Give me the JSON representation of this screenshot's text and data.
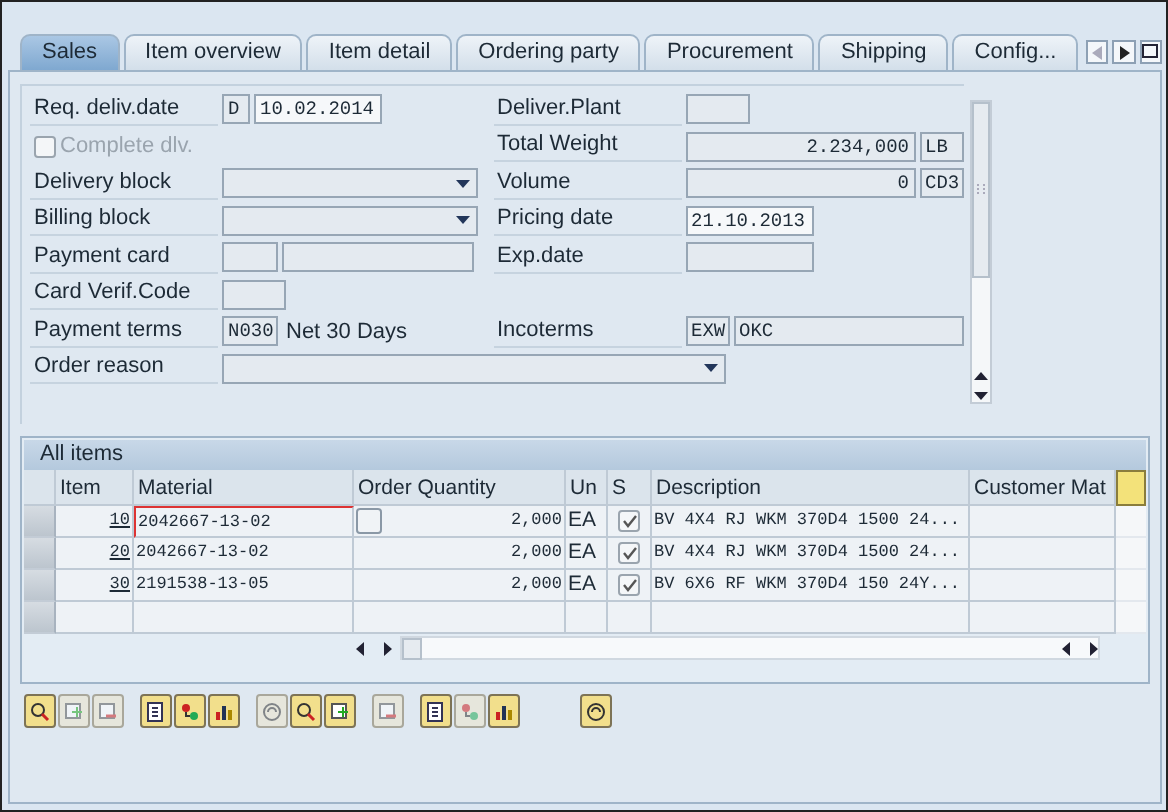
{
  "tabs": [
    {
      "label": "Sales",
      "selected": true
    },
    {
      "label": "Item overview",
      "selected": false
    },
    {
      "label": "Item detail",
      "selected": false
    },
    {
      "label": "Ordering party",
      "selected": false
    },
    {
      "label": "Procurement",
      "selected": false
    },
    {
      "label": "Shipping",
      "selected": false
    },
    {
      "label": "Config...",
      "selected": false
    }
  ],
  "form": {
    "rows": [
      {
        "left": {
          "kind": "label",
          "label": "Req. deliv.date",
          "controls": [
            {
              "kind": "flag",
              "value": "D"
            },
            {
              "kind": "date",
              "value": "10.02.2014"
            }
          ]
        },
        "right": {
          "kind": "label",
          "label": "Deliver.Plant",
          "controls": [
            {
              "kind": "short"
            }
          ]
        }
      },
      {
        "left": {
          "kind": "checkbox",
          "label": "Complete dlv.",
          "checked": false,
          "disabled": true
        },
        "right": {
          "kind": "label",
          "label": "Total Weight",
          "controls": [
            {
              "kind": "amount",
              "value": "2.234,000"
            },
            {
              "kind": "unit",
              "value": "LB"
            }
          ]
        }
      },
      {
        "left": {
          "kind": "label",
          "label": "Delivery block",
          "controls": [
            {
              "kind": "dropdown"
            }
          ]
        },
        "right": {
          "kind": "label",
          "label": "Volume",
          "controls": [
            {
              "kind": "amount",
              "value": "0"
            },
            {
              "kind": "unit",
              "value": "CD3"
            }
          ]
        }
      },
      {
        "left": {
          "kind": "label",
          "label": "Billing block",
          "controls": [
            {
              "kind": "dropdown"
            }
          ]
        },
        "right": {
          "kind": "label",
          "label": "Pricing date",
          "controls": [
            {
              "kind": "date",
              "value": "21.10.2013"
            }
          ]
        }
      },
      {
        "left": {
          "kind": "label",
          "label": "Payment card",
          "controls": [
            {
              "kind": "code"
            },
            {
              "kind": "medium"
            }
          ]
        },
        "right": {
          "kind": "label",
          "label": "Exp.date",
          "controls": [
            {
              "kind": "date"
            }
          ]
        }
      },
      {
        "left": {
          "kind": "label",
          "label": "Card Verif.Code",
          "controls": [
            {
              "kind": "short"
            }
          ]
        }
      },
      {
        "left": {
          "kind": "label",
          "label": "Payment terms",
          "controls": [
            {
              "kind": "code",
              "value": "N030"
            },
            {
              "kind": "text",
              "value": "Net 30 Days"
            }
          ]
        },
        "right": {
          "kind": "label",
          "label": "Incoterms",
          "controls": [
            {
              "kind": "unit",
              "value": "EXW"
            },
            {
              "kind": "wide",
              "value": "OKC"
            }
          ]
        }
      },
      {
        "left": {
          "kind": "label",
          "label": "Order reason",
          "controls": [
            {
              "kind": "longdropdown"
            }
          ]
        }
      }
    ]
  },
  "table": {
    "title": "All items",
    "columns": [
      "Item",
      "Material",
      "Order Quantity",
      "Un",
      "S",
      "Description",
      "Customer Mat"
    ],
    "rows": [
      {
        "item": "10",
        "material": "2042667-13-02",
        "quantity": "2,000",
        "unit": "EA",
        "status": true,
        "description": "BV 4X4 RJ WKM 370D4 1500 24...",
        "focused": true
      },
      {
        "item": "20",
        "material": "2042667-13-02",
        "quantity": "2,000",
        "unit": "EA",
        "status": true,
        "description": "BV 4X4 RJ WKM 370D4 1500 24...",
        "focused": false
      },
      {
        "item": "30",
        "material": "2191538-13-05",
        "quantity": "2,000",
        "unit": "EA",
        "status": true,
        "description": "BV 6X6 RF WKM 370D4 150 24Y...",
        "focused": false
      }
    ]
  },
  "toolbar": [
    [
      {
        "disabled": false
      },
      {
        "disabled": true
      },
      {
        "disabled": true
      }
    ],
    [
      {
        "disabled": false
      },
      {
        "disabled": false
      },
      {
        "disabled": false
      }
    ],
    [
      {
        "disabled": true
      },
      {
        "disabled": false
      },
      {
        "disabled": false
      }
    ],
    [
      {
        "disabled": true
      }
    ],
    [
      {
        "disabled": false
      },
      {
        "disabled": true
      },
      {
        "disabled": false
      }
    ],
    [
      {
        "disabled": false
      }
    ]
  ]
}
